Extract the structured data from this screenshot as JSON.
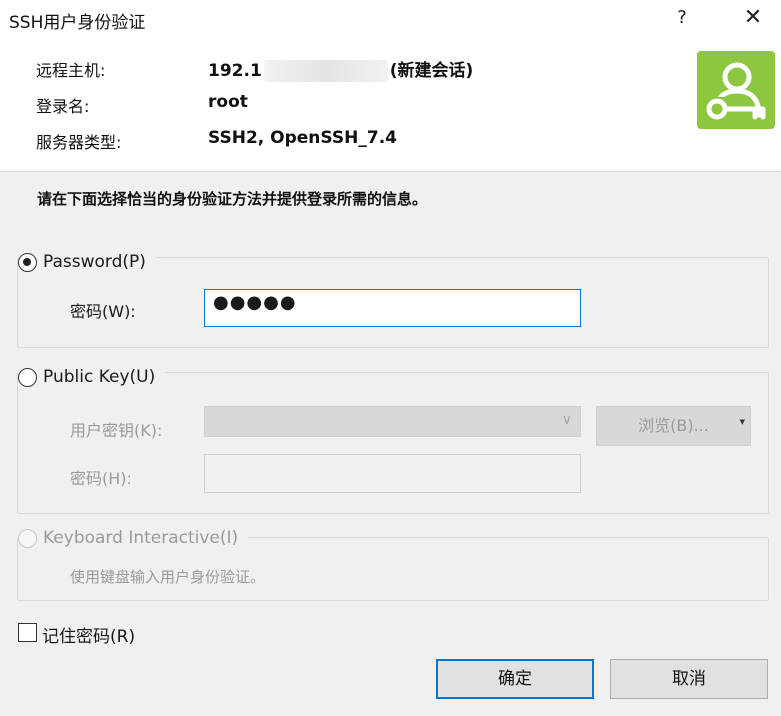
{
  "window": {
    "title": "SSH用户身份验证",
    "help_glyph": "?",
    "close_glyph": "✕"
  },
  "info": {
    "host_label": "远程主机:",
    "host_value_prefix": "192.1",
    "host_value_suffix": "(新建会话)",
    "login_label": "登录名:",
    "login_value": "root",
    "server_type_label": "服务器类型:",
    "server_type_value": "SSH2, OpenSSH_7.4",
    "icon": "user-key-icon",
    "icon_color": "#8dc63f"
  },
  "instruction": "请在下面选择恰当的身份验证方法并提供登录所需的信息。",
  "password_method": {
    "label": "Password(P)",
    "selected": true,
    "field_label": "密码(W):",
    "field_value": "●●●●●"
  },
  "public_key_method": {
    "label": "Public Key(U)",
    "selected": false,
    "key_label": "用户密钥(K):",
    "key_value": "",
    "browse_label": "浏览(B)...",
    "passphrase_label": "密码(H):",
    "passphrase_value": ""
  },
  "keyboard_method": {
    "label": "Keyboard Interactive(I)",
    "selected": false,
    "description": "使用键盘输入用户身份验证。"
  },
  "remember_password": {
    "label": "记住密码(R)",
    "checked": false
  },
  "buttons": {
    "ok": "确定",
    "cancel": "取消"
  },
  "colors": {
    "accent": "#0078d7",
    "dialog_bg": "#f0f0f0",
    "disabled_text": "#9a9a9a"
  }
}
